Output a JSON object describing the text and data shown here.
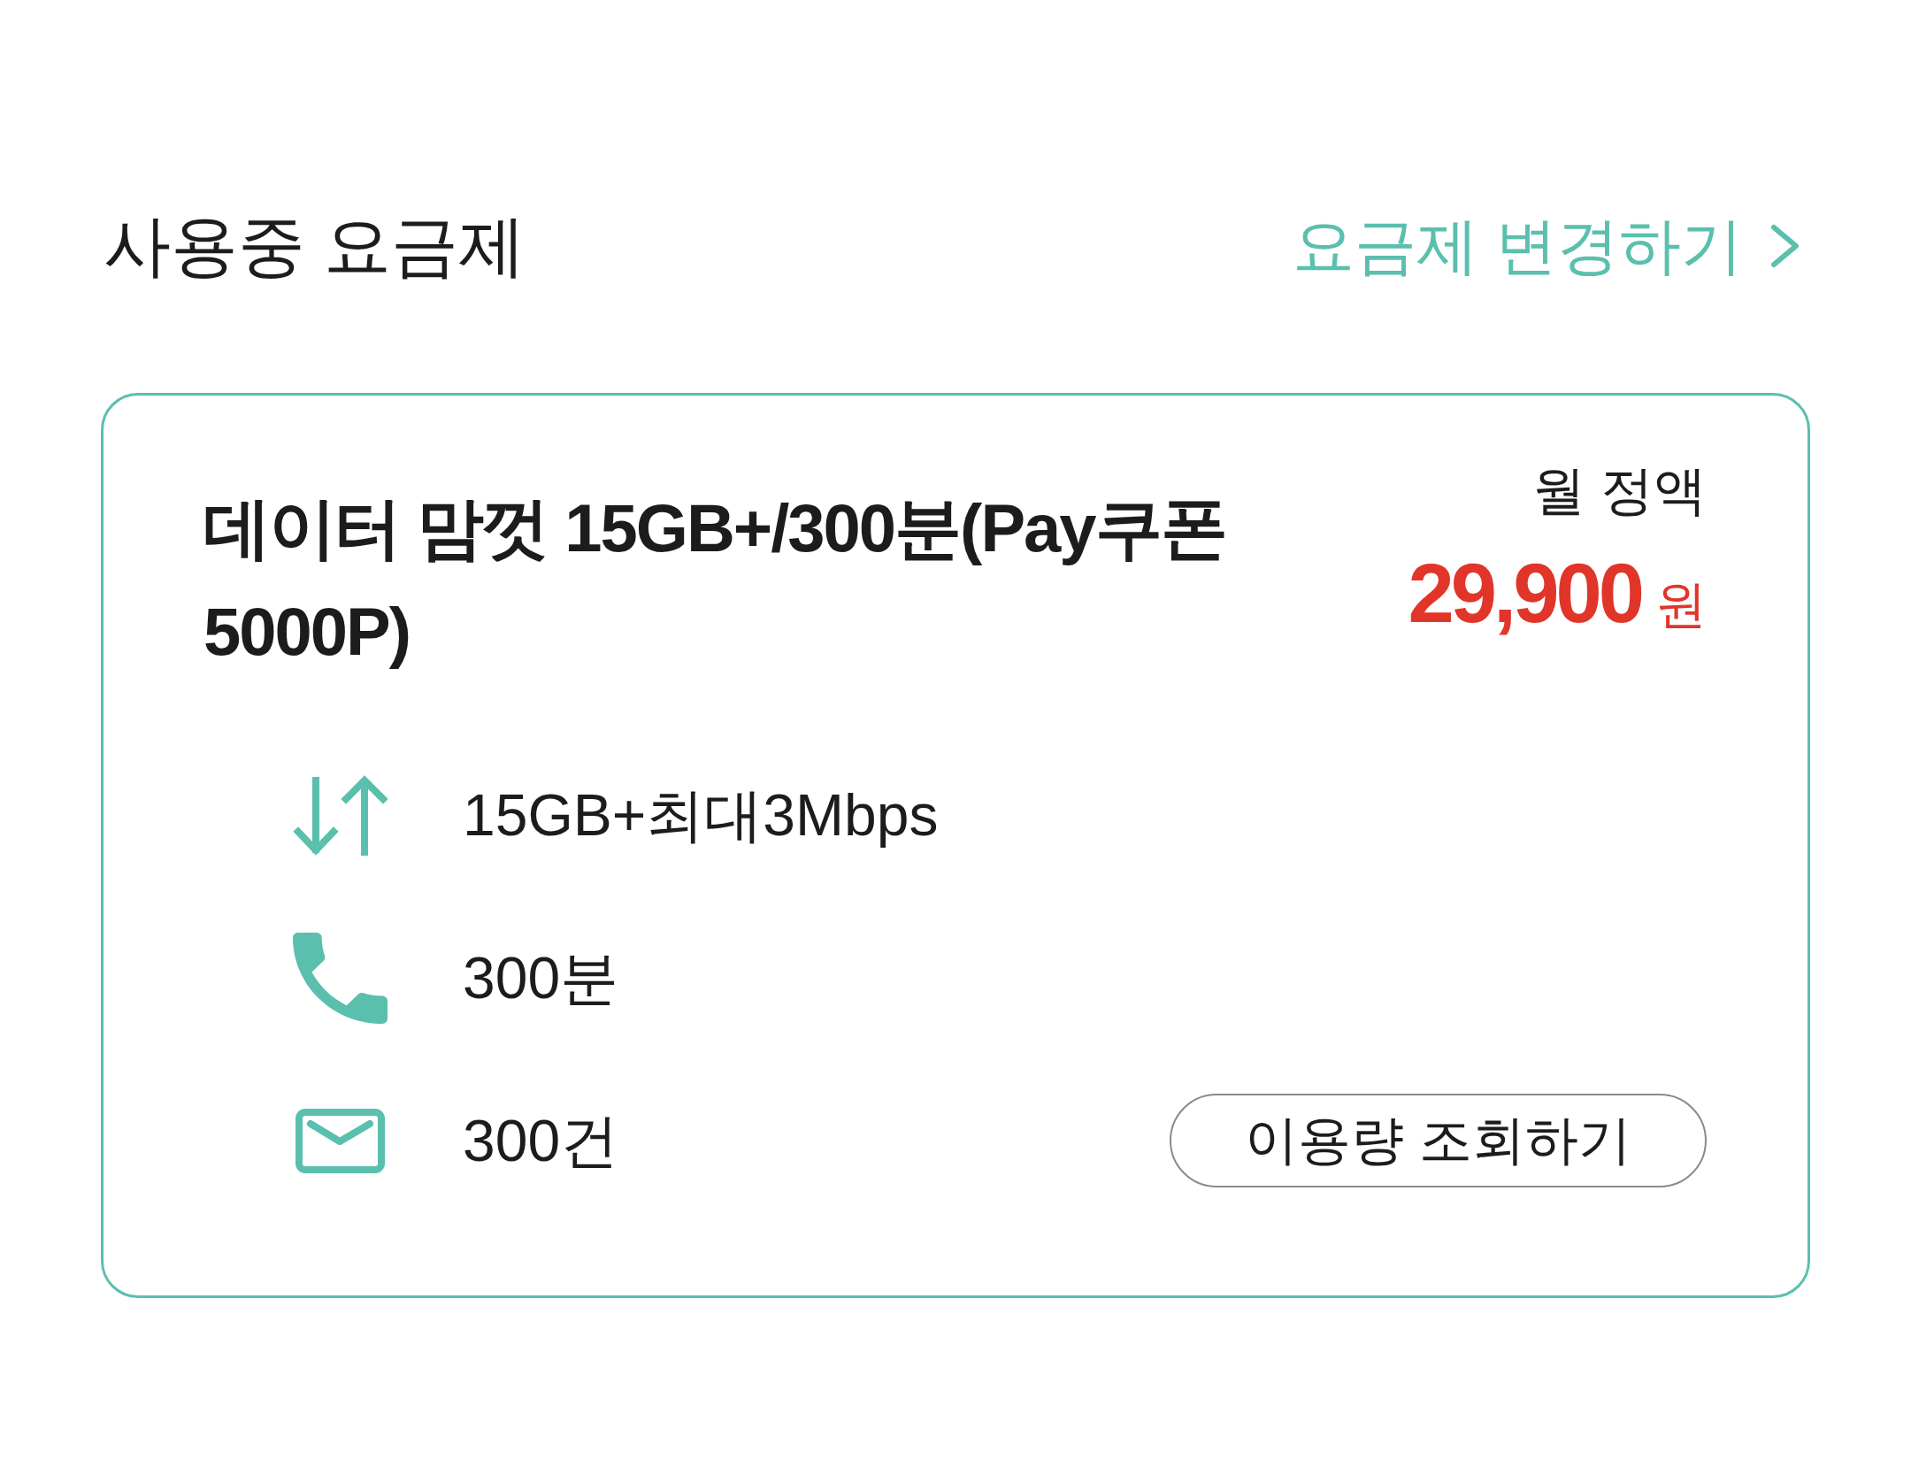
{
  "header": {
    "title": "사용중 요금제",
    "link": {
      "label": "요금제 변경하기"
    }
  },
  "plan": {
    "name": "데이터 맘껏 15GB+/300분(Pay쿠폰 5000P)",
    "price_label": "월 정액",
    "price": "29,900",
    "currency": "원",
    "features": [
      {
        "kind": "data",
        "text": "15GB+최대3Mbps"
      },
      {
        "kind": "voice",
        "text": "300분"
      },
      {
        "kind": "message",
        "text": "300건"
      }
    ],
    "button": {
      "label": "이용량 조회하기"
    }
  }
}
